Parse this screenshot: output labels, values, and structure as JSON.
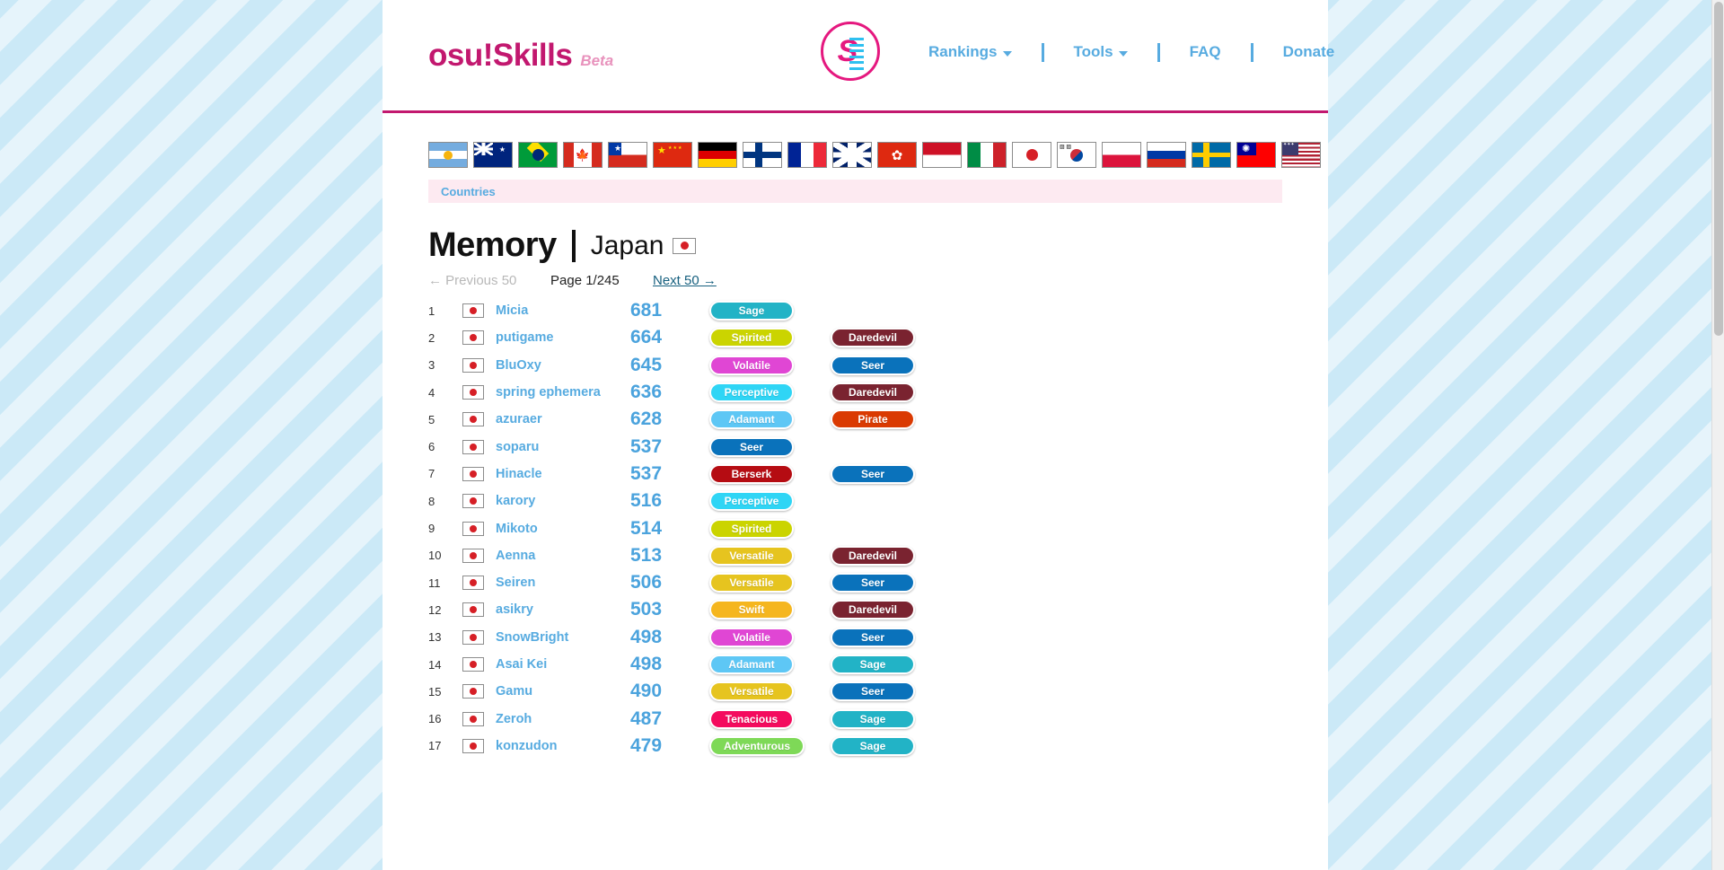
{
  "header": {
    "logo_main": "osu!Skills",
    "logo_beta": "Beta",
    "emblem_letter": "S",
    "nav": [
      {
        "label": "Rankings",
        "has_caret": true
      },
      {
        "label": "Tools",
        "has_caret": true
      },
      {
        "label": "FAQ",
        "has_caret": false
      },
      {
        "label": "Donate",
        "has_caret": false
      }
    ]
  },
  "flag_strip": {
    "flags": [
      {
        "code": "ar",
        "name": "Argentina"
      },
      {
        "code": "au",
        "name": "Australia"
      },
      {
        "code": "br",
        "name": "Brazil"
      },
      {
        "code": "ca",
        "name": "Canada"
      },
      {
        "code": "cl",
        "name": "Chile"
      },
      {
        "code": "cn",
        "name": "China"
      },
      {
        "code": "de",
        "name": "Germany"
      },
      {
        "code": "fi",
        "name": "Finland"
      },
      {
        "code": "fr",
        "name": "France"
      },
      {
        "code": "gb",
        "name": "United Kingdom"
      },
      {
        "code": "hk",
        "name": "Hong Kong"
      },
      {
        "code": "id",
        "name": "Indonesia"
      },
      {
        "code": "it",
        "name": "Italy"
      },
      {
        "code": "jp",
        "name": "Japan"
      },
      {
        "code": "kr",
        "name": "South Korea"
      },
      {
        "code": "pl",
        "name": "Poland"
      },
      {
        "code": "ru",
        "name": "Russia"
      },
      {
        "code": "se",
        "name": "Sweden"
      },
      {
        "code": "tw",
        "name": "Taiwan"
      },
      {
        "code": "us",
        "name": "United States"
      }
    ]
  },
  "countries_bar": {
    "label": "Countries"
  },
  "title": {
    "skill": "Memory",
    "country": "Japan",
    "country_flag": "jp"
  },
  "pager": {
    "previous": "← Previous 50",
    "page": "Page 1/245",
    "next": "Next 50 →"
  },
  "badge_colors": {
    "Sage": "#22b3c6",
    "Spirited": "#cbd400",
    "Volatile": "#e046d4",
    "Perceptive": "#2fd5f5",
    "Adamant": "#5ec7f5",
    "Seer": "#0a72bb",
    "Daredevil": "#7a2330",
    "Pirate": "#da3a02",
    "Berserk": "#b50c12",
    "Versatile": "#e6c41f",
    "Swift": "#f5b61f",
    "Tenacious": "#f40b5e",
    "Adventurous": "#7ed957"
  },
  "rankings": [
    {
      "rank": "1",
      "flag": "jp",
      "name": "Micia",
      "score": "681",
      "badges": [
        "Sage"
      ]
    },
    {
      "rank": "2",
      "flag": "jp",
      "name": "putigame",
      "score": "664",
      "badges": [
        "Spirited",
        "Daredevil"
      ]
    },
    {
      "rank": "3",
      "flag": "jp",
      "name": "BluOxy",
      "score": "645",
      "badges": [
        "Volatile",
        "Seer"
      ]
    },
    {
      "rank": "4",
      "flag": "jp",
      "name": "spring ephemera",
      "score": "636",
      "badges": [
        "Perceptive",
        "Daredevil"
      ]
    },
    {
      "rank": "5",
      "flag": "jp",
      "name": "azuraer",
      "score": "628",
      "badges": [
        "Adamant",
        "Pirate"
      ]
    },
    {
      "rank": "6",
      "flag": "jp",
      "name": "soparu",
      "score": "537",
      "badges": [
        "Seer"
      ]
    },
    {
      "rank": "7",
      "flag": "jp",
      "name": "Hinacle",
      "score": "537",
      "badges": [
        "Berserk",
        "Seer"
      ]
    },
    {
      "rank": "8",
      "flag": "jp",
      "name": "karory",
      "score": "516",
      "badges": [
        "Perceptive"
      ]
    },
    {
      "rank": "9",
      "flag": "jp",
      "name": "Mikoto",
      "score": "514",
      "badges": [
        "Spirited"
      ]
    },
    {
      "rank": "10",
      "flag": "jp",
      "name": "Aenna",
      "score": "513",
      "badges": [
        "Versatile",
        "Daredevil"
      ]
    },
    {
      "rank": "11",
      "flag": "jp",
      "name": "Seiren",
      "score": "506",
      "badges": [
        "Versatile",
        "Seer"
      ]
    },
    {
      "rank": "12",
      "flag": "jp",
      "name": "asikry",
      "score": "503",
      "badges": [
        "Swift",
        "Daredevil"
      ]
    },
    {
      "rank": "13",
      "flag": "jp",
      "name": "SnowBright",
      "score": "498",
      "badges": [
        "Volatile",
        "Seer"
      ]
    },
    {
      "rank": "14",
      "flag": "jp",
      "name": "Asai Kei",
      "score": "498",
      "badges": [
        "Adamant",
        "Sage"
      ]
    },
    {
      "rank": "15",
      "flag": "jp",
      "name": "Gamu",
      "score": "490",
      "badges": [
        "Versatile",
        "Seer"
      ]
    },
    {
      "rank": "16",
      "flag": "jp",
      "name": "Zeroh",
      "score": "487",
      "badges": [
        "Tenacious",
        "Sage"
      ]
    },
    {
      "rank": "17",
      "flag": "jp",
      "name": "konzudon",
      "score": "479",
      "badges": [
        "Adventurous",
        "Sage"
      ]
    }
  ]
}
